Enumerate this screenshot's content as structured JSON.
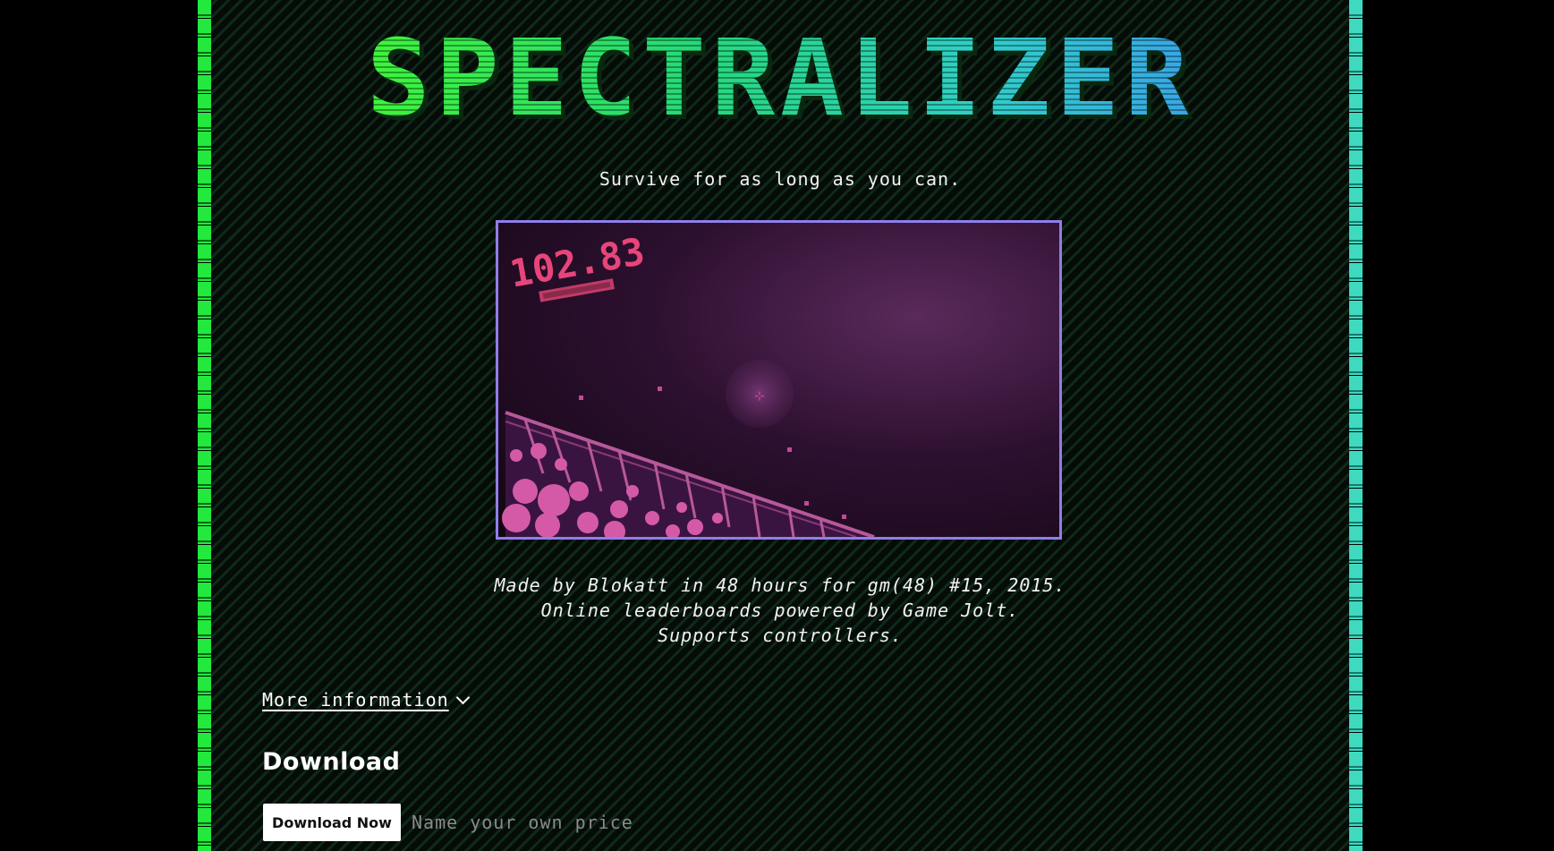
{
  "game": {
    "title": "SPECTRALIZER",
    "tagline": "Survive for as long as you can."
  },
  "screenshot": {
    "score": "102.83"
  },
  "description": {
    "line1": "Made by Blokatt in 48 hours for gm(48) #15, 2015.",
    "line2": "Online leaderboards powered by Game Jolt.",
    "line3": "Supports controllers."
  },
  "more_info": {
    "label": "More information",
    "icon": "chevron-down-icon"
  },
  "download": {
    "heading": "Download",
    "button_label": "Download Now",
    "price_label": "Name your own price"
  },
  "colors": {
    "background": "#000000",
    "border_left": "#23e83d",
    "border_right": "#3fd9c0",
    "frame_border": "#8f7ee8",
    "score_color": "#e8457a"
  }
}
